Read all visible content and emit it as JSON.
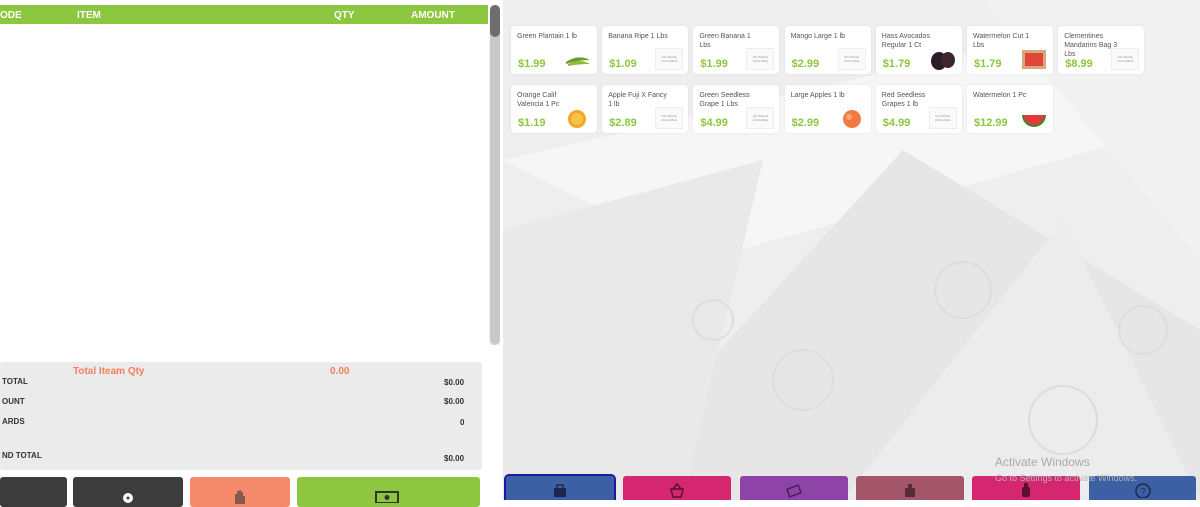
{
  "table": {
    "headers": {
      "code": "ODE",
      "item": "ITEM",
      "qty": "QTY",
      "amount": "AMOUNT"
    }
  },
  "totals": {
    "item_qty_label": "Total Iteam Qty",
    "item_qty_value": "0.00",
    "subtotal_label": "TOTAL",
    "subtotal_value": "$0.00",
    "discount_label": "OUNT",
    "discount_value": "$0.00",
    "cards_label": "ARDS",
    "cards_value": "0",
    "grand_label": "ND TOTAL",
    "grand_value": "$0.00"
  },
  "bottom_buttons": [
    {
      "icon": "dark-button",
      "color": "#3c3c3c"
    },
    {
      "icon": "tag-icon",
      "color": "#3c3c3c"
    },
    {
      "icon": "hold-hand-icon",
      "color": "#f58a6b"
    },
    {
      "icon": "cash-icon",
      "color": "#8dc63f"
    }
  ],
  "products": [
    {
      "name": "Green Plantain 1 lb",
      "price": "$1.99",
      "image": "plantain"
    },
    {
      "name": "Banana Ripe 1 Lbs",
      "price": "$1.09",
      "image": "none"
    },
    {
      "name": "Green Banana 1 Lbs",
      "price": "$1.99",
      "image": "none"
    },
    {
      "name": "Mango Large 1 lb",
      "price": "$2.99",
      "image": "none"
    },
    {
      "name": "Hass Avocados Regular 1 Ct",
      "price": "$1.79",
      "image": "avocado"
    },
    {
      "name": "Watermelon Cut 1 Lbs",
      "price": "$1.79",
      "image": "watermelon-cut"
    },
    {
      "name": "Clementines Mandarins Bag 3 Lbs",
      "price": "$8.99",
      "image": "none"
    },
    {
      "name": "Orange Calif Valencia 1 Pc",
      "price": "$1.19",
      "image": "orange"
    },
    {
      "name": "Apple Fuji X Fancy 1 lb",
      "price": "$2.89",
      "image": "none"
    },
    {
      "name": "Green Seedless Grape 1 Lbs",
      "price": "$4.99",
      "image": "none"
    },
    {
      "name": "Large Apples 1 lb",
      "price": "$2.99",
      "image": "apple"
    },
    {
      "name": "Red Seedless Grapes 1 lb",
      "price": "$4.99",
      "image": "none"
    },
    {
      "name": "Watermelon 1 Pc",
      "price": "$12.99",
      "image": "watermelon"
    }
  ],
  "no_image_text": "NO IMAGE AVAILABLE",
  "nav_buttons": [
    {
      "icon": "bag-icon",
      "color": "#3d5fa3"
    },
    {
      "icon": "basket-icon",
      "color": "#d52670"
    },
    {
      "icon": "coupon-icon",
      "color": "#8e44a6"
    },
    {
      "icon": "scale-icon",
      "color": "#a3566a"
    },
    {
      "icon": "bottle-icon",
      "color": "#d52670"
    },
    {
      "icon": "help-icon",
      "color": "#3d5fa3"
    }
  ],
  "watermark": {
    "title": "Activate Windows",
    "subtitle": "Go to Settings to activate Windows."
  }
}
